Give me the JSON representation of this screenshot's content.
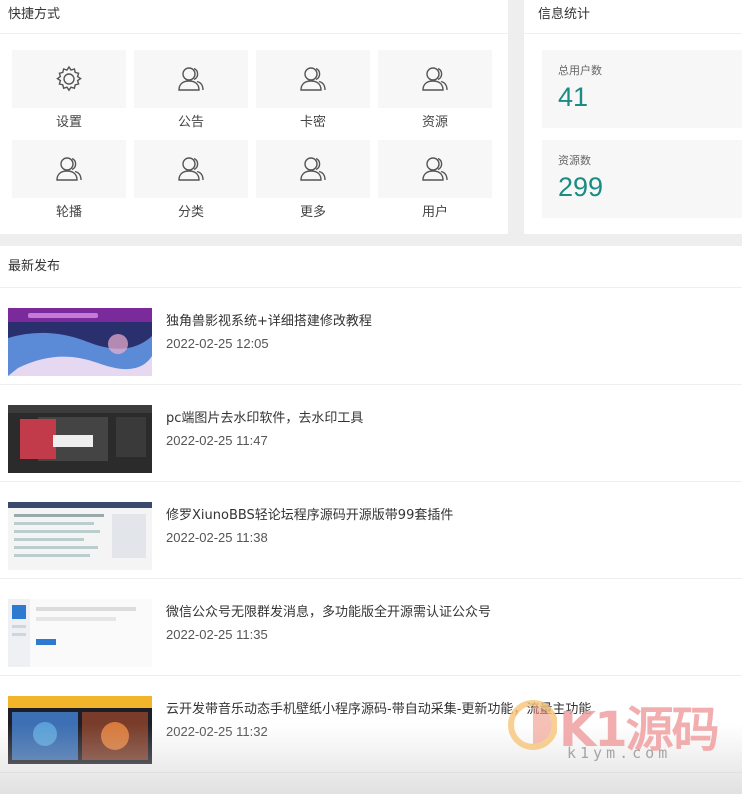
{
  "quick": {
    "title": "快捷方式",
    "items": [
      {
        "label": "设置",
        "icon": "gear-icon"
      },
      {
        "label": "公告",
        "icon": "users-icon"
      },
      {
        "label": "卡密",
        "icon": "users-icon"
      },
      {
        "label": "资源",
        "icon": "users-icon"
      },
      {
        "label": "轮播",
        "icon": "users-icon"
      },
      {
        "label": "分类",
        "icon": "users-icon"
      },
      {
        "label": "更多",
        "icon": "users-icon"
      },
      {
        "label": "用户",
        "icon": "users-icon"
      }
    ]
  },
  "stats": {
    "title": "信息统计",
    "users_label": "总用户数",
    "users_value": "41",
    "resources_label": "资源数",
    "resources_value": "299",
    "accent": "#1a8c84"
  },
  "latest": {
    "title": "最新发布",
    "posts": [
      {
        "title": "独角兽影视系统+详细搭建修改教程",
        "date": "2022-02-25 12:05"
      },
      {
        "title": "pc端图片去水印软件，去水印工具",
        "date": "2022-02-25 11:47"
      },
      {
        "title": "修罗XiunoBBS轻论坛程序源码开源版带99套插件",
        "date": "2022-02-25 11:38"
      },
      {
        "title": "微信公众号无限群发消息，多功能版全开源需认证公众号",
        "date": "2022-02-25 11:35"
      },
      {
        "title": "云开发带音乐动态手机壁纸小程序源码-带自动采集-更新功能，流量主功能",
        "date": "2022-02-25 11:32"
      }
    ]
  },
  "watermark": {
    "main": "K1源码",
    "sub": "k1ym.com"
  }
}
